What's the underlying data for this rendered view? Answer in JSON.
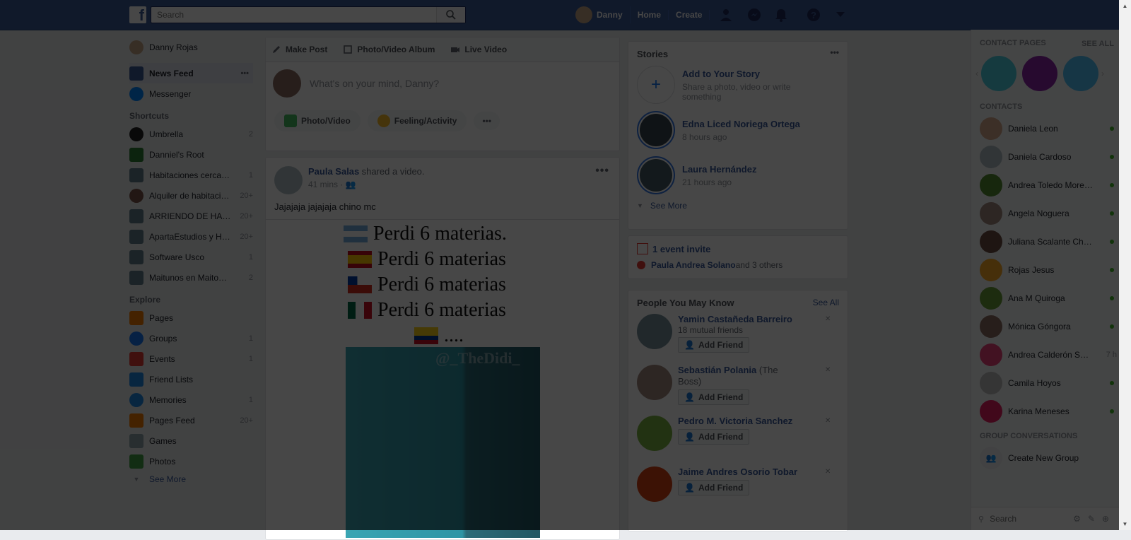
{
  "topbar": {
    "logo": "f",
    "search_placeholder": "Search",
    "user": "Danny",
    "home": "Home",
    "create": "Create"
  },
  "left": {
    "user": "Danny Rojas",
    "main": [
      {
        "label": "News Feed",
        "more": "•••"
      },
      {
        "label": "Messenger"
      }
    ],
    "shortcuts_title": "Shortcuts",
    "shortcuts": [
      {
        "label": "Umbrella",
        "count": "2",
        "color": "#212121"
      },
      {
        "label": "Danniel's Root",
        "count": "",
        "color": "#2e7d32"
      },
      {
        "label": "Habitaciones cerca…",
        "count": "1",
        "color": "#607d8b"
      },
      {
        "label": "Alquiler de habitaci…",
        "count": "20+",
        "color": "#795548"
      },
      {
        "label": "ARRIENDO DE HA…",
        "count": "20+",
        "color": "#607d8b"
      },
      {
        "label": "ApartaEstudios y H…",
        "count": "20+",
        "color": "#607d8b"
      },
      {
        "label": "Software Usco",
        "count": "1",
        "color": "#607d8b"
      },
      {
        "label": "Maitunos en Maito…",
        "count": "2",
        "color": "#607d8b"
      }
    ],
    "explore_title": "Explore",
    "explore": [
      {
        "label": "Pages",
        "count": "",
        "color": "#f57c00"
      },
      {
        "label": "Groups",
        "count": "1",
        "color": "#1877f2"
      },
      {
        "label": "Events",
        "count": "1",
        "color": "#e53935"
      },
      {
        "label": "Friend Lists",
        "count": "",
        "color": "#1e88e5"
      },
      {
        "label": "Memories",
        "count": "1",
        "color": "#1e88e5"
      },
      {
        "label": "Pages Feed",
        "count": "20+",
        "color": "#f57c00"
      },
      {
        "label": "Games",
        "count": "",
        "color": "#90a4ae"
      },
      {
        "label": "Photos",
        "count": "",
        "color": "#43a047"
      }
    ],
    "see_more": "See More"
  },
  "composer": {
    "tabs": [
      "Make Post",
      "Photo/Video Album",
      "Live Video"
    ],
    "placeholder": "What's on your mind, Danny?",
    "buttons": [
      "Photo/Video",
      "Feeling/Activity"
    ],
    "more": "•••"
  },
  "post": {
    "author": "Paula Salas",
    "action": "shared a video.",
    "time": "41 mins",
    "text": "Jajajaja jajajaja chino mc",
    "media_lines": [
      "Perdi 6 materias.",
      "Perdi 6 materias",
      "Perdi 6 materias",
      "Perdi 6 materias"
    ],
    "last_line": "....",
    "watermark": "@_TheDidi_",
    "more": "•••"
  },
  "stories": {
    "title": "Stories",
    "more": "•••",
    "add_title": "Add to Your Story",
    "add_sub": "Share a photo, video or write something",
    "items": [
      {
        "name": "Edna Liced Noriega Ortega",
        "time": "8 hours ago"
      },
      {
        "name": "Laura Hernández",
        "time": "21 hours ago"
      }
    ],
    "see_more": "See More"
  },
  "events": {
    "title": "1 event invite",
    "who": "Paula Andrea Solano",
    "others": " and 3 others"
  },
  "pymk": {
    "title": "People You May Know",
    "see_all": "See All",
    "add_label": "Add Friend",
    "people": [
      {
        "name": "Yamin Castañeda Barreiro",
        "extra": "18 mutual friends"
      },
      {
        "name": "Sebastián Polania",
        "extra": "(The Boss)"
      },
      {
        "name": "Pedro M. Victoria Sanchez",
        "extra": ""
      },
      {
        "name": "Jaime Andres Osorio Tobar",
        "extra": ""
      }
    ]
  },
  "chat": {
    "contact_pages": "Contact Pages",
    "see_all": "SEE ALL",
    "contacts_title": "Contacts",
    "contacts": [
      {
        "name": "Daniela Leon",
        "time": ""
      },
      {
        "name": "Daniela Cardoso",
        "time": ""
      },
      {
        "name": "Andrea Toledo Moreno",
        "time": ""
      },
      {
        "name": "Angela Noguera",
        "time": ""
      },
      {
        "name": "Juliana Scalante Cha…",
        "time": ""
      },
      {
        "name": "Rojas Jesus",
        "time": ""
      },
      {
        "name": "Ana M Quiroga",
        "time": ""
      },
      {
        "name": "Mónica Góngora",
        "time": ""
      },
      {
        "name": "Andrea Calderón S…",
        "time": "7 h"
      },
      {
        "name": "Camila Hoyos",
        "time": ""
      },
      {
        "name": "Karina Meneses",
        "time": ""
      }
    ],
    "group_title": "Group Conversations",
    "create_group": "Create New Group",
    "search_placeholder": "Search"
  }
}
